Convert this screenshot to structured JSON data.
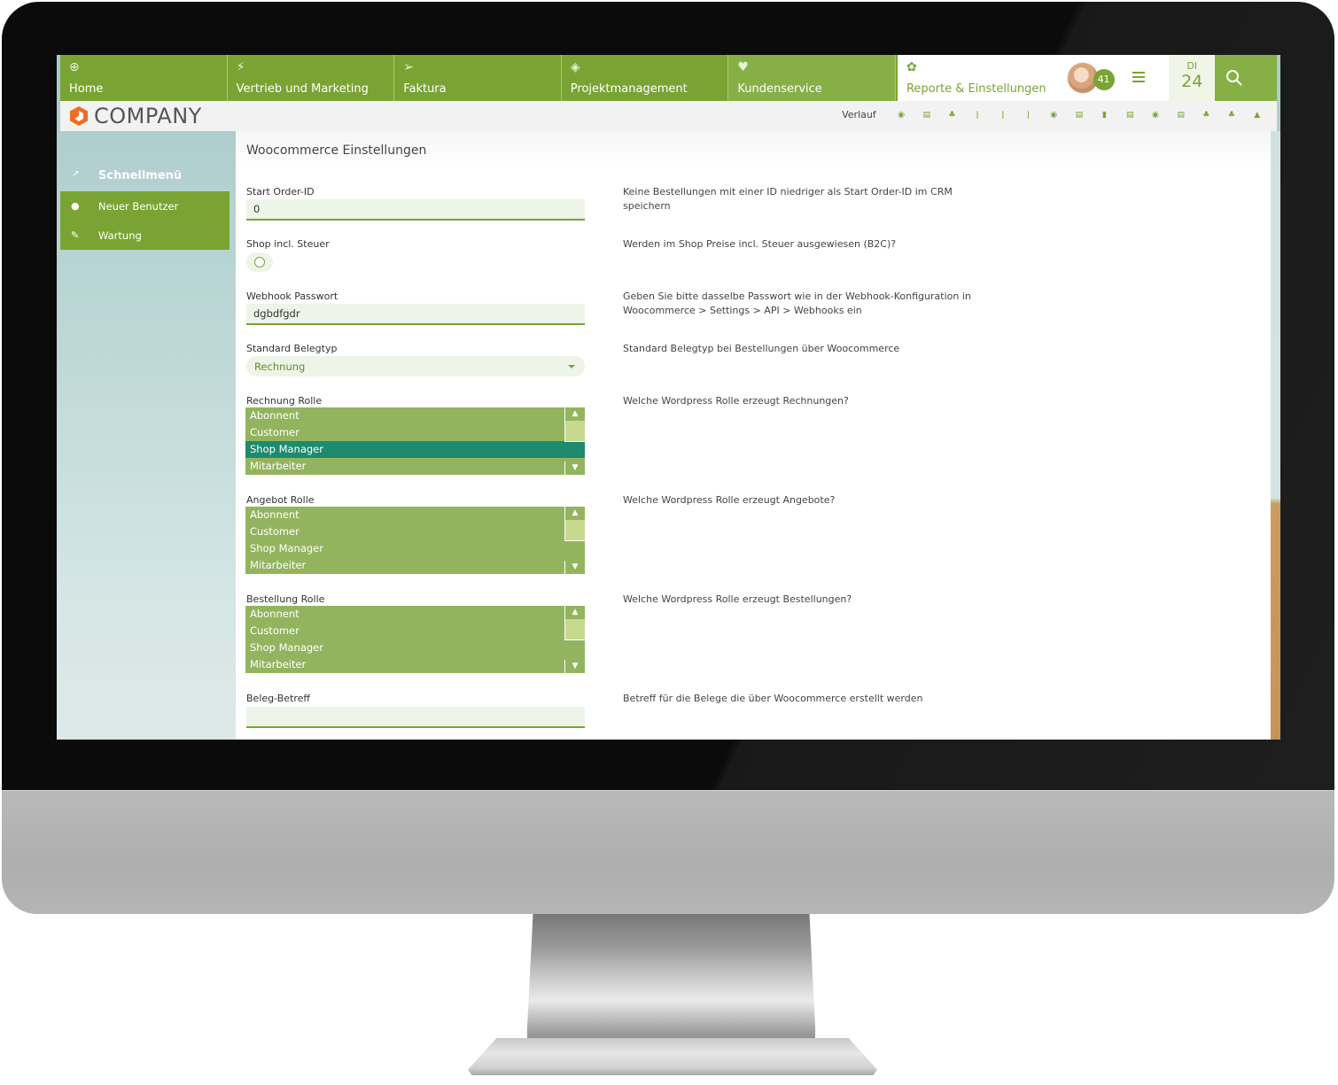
{
  "nav": {
    "tabs": [
      {
        "label": "Home",
        "icon": "globe-icon",
        "glyph": "⊕"
      },
      {
        "label": "Vertrieb und Marketing",
        "icon": "lightning-icon",
        "glyph": "⚡"
      },
      {
        "label": "Faktura",
        "icon": "paper-plane-icon",
        "glyph": "➢"
      },
      {
        "label": "Projektmanagement",
        "icon": "cube-icon",
        "glyph": "◈"
      },
      {
        "label": "Kundenservice",
        "icon": "heart-icon",
        "glyph": "♥"
      },
      {
        "label": "Reporte & Einstellungen",
        "icon": "gear-icon",
        "glyph": "✿",
        "active": true
      }
    ],
    "notification_count": "41",
    "date": {
      "weekday": "DI",
      "day": "24"
    }
  },
  "brand": {
    "name": "COMPANY"
  },
  "history": {
    "label": "Verlauf",
    "icons": [
      {
        "name": "soccer-ball-icon",
        "glyph": "◉"
      },
      {
        "name": "calculator-icon",
        "glyph": "▤"
      },
      {
        "name": "award-icon",
        "glyph": "♣"
      },
      {
        "name": "thermometer-icon",
        "glyph": "ǀ"
      },
      {
        "name": "thermometer-icon",
        "glyph": "ǀ"
      },
      {
        "name": "thermometer-icon",
        "glyph": "ǀ"
      },
      {
        "name": "soccer-ball-icon",
        "glyph": "◉"
      },
      {
        "name": "document-icon",
        "glyph": "▤"
      },
      {
        "name": "book-icon",
        "glyph": "▮"
      },
      {
        "name": "document-icon",
        "glyph": "▤"
      },
      {
        "name": "soccer-ball-icon",
        "glyph": "◉"
      },
      {
        "name": "document-icon",
        "glyph": "▤"
      },
      {
        "name": "award-icon",
        "glyph": "♣"
      },
      {
        "name": "award-icon",
        "glyph": "♣"
      },
      {
        "name": "rocket-icon",
        "glyph": "▲"
      }
    ]
  },
  "sidebar": {
    "title": "Schnellmenü",
    "items": [
      {
        "label": "Neuer Benutzer",
        "icon": "user-icon",
        "glyph": "●"
      },
      {
        "label": "Wartung",
        "icon": "wrench-icon",
        "glyph": "✎"
      }
    ]
  },
  "page": {
    "title": "Woocommerce Einstellungen",
    "fields": {
      "start_order_id": {
        "label": "Start Order-ID",
        "value": "0",
        "help": "Keine Bestellungen mit einer ID niedriger als Start Order-ID im CRM speichern"
      },
      "shop_incl_tax": {
        "label": "Shop incl. Steuer",
        "checked": false,
        "help": "Werden im Shop Preise incl. Steuer ausgewiesen (B2C)?"
      },
      "webhook_password": {
        "label": "Webhook Passwort",
        "value": "dgbdfgdr",
        "help_line1": "Geben Sie bitte dasselbe Passwort wie in der Webhook-Konfiguration in",
        "help_line2": "Woocommerce > Settings > API > Webhooks ein"
      },
      "default_doc_type": {
        "label": "Standard Belegtyp",
        "value": "Rechnung",
        "help": "Standard Belegtyp bei Bestellungen über Woocommerce"
      },
      "invoice_role": {
        "label": "Rechnung Rolle",
        "options": [
          "Abonnent",
          "Customer",
          "Shop Manager",
          "Mitarbeiter"
        ],
        "selected": "Shop Manager",
        "help": "Welche Wordpress Rolle erzeugt Rechnungen?"
      },
      "offer_role": {
        "label": "Angebot Rolle",
        "options": [
          "Abonnent",
          "Customer",
          "Shop Manager",
          "Mitarbeiter"
        ],
        "selected": null,
        "help": "Welche Wordpress Rolle erzeugt Angebote?"
      },
      "order_role": {
        "label": "Bestellung Rolle",
        "options": [
          "Abonnent",
          "Customer",
          "Shop Manager",
          "Mitarbeiter"
        ],
        "selected": null,
        "help": "Welche Wordpress Rolle erzeugt Bestellungen?"
      },
      "doc_subject": {
        "label": "Beleg-Betreff",
        "value": "",
        "help": "Betreff für die Belege die über Woocommerce erstellt werden"
      }
    }
  },
  "colors": {
    "brand_green": "#79a433",
    "list_green": "#93b45e",
    "selected_teal": "#1e8a6e",
    "logo_orange": "#f26b21"
  }
}
